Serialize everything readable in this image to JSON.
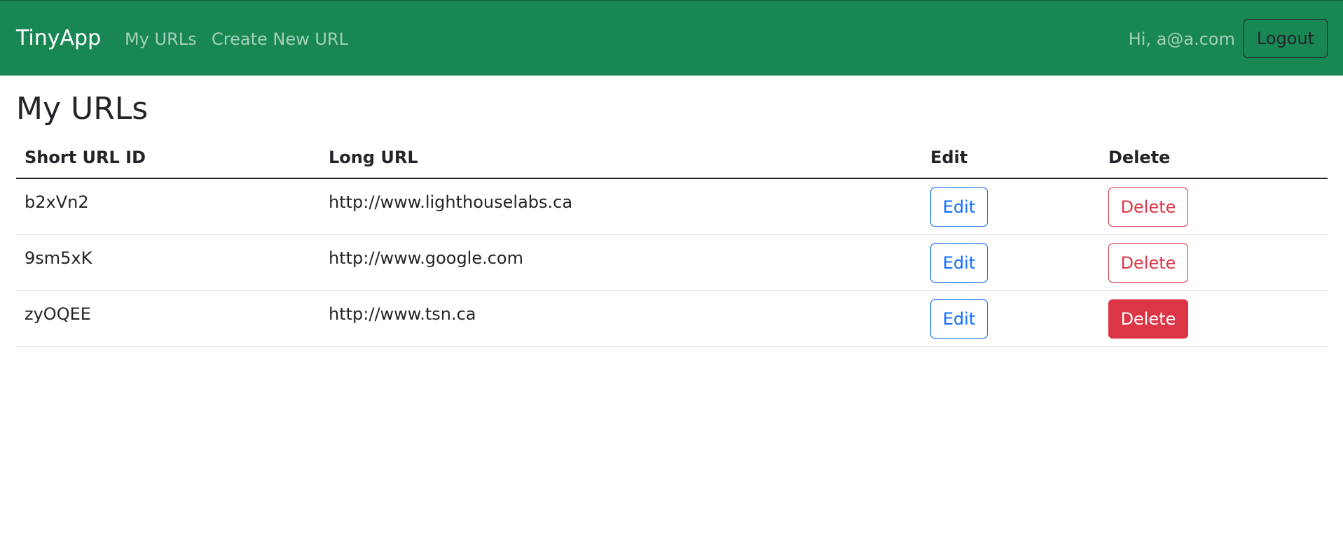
{
  "navbar": {
    "brand": "TinyApp",
    "links": [
      {
        "label": "My URLs"
      },
      {
        "label": "Create New URL"
      }
    ],
    "greeting": "Hi, a@a.com",
    "logout_label": "Logout",
    "background_color": "#198754"
  },
  "main": {
    "title": "My URLs",
    "table": {
      "headers": [
        "Short URL ID",
        "Long URL",
        "Edit",
        "Delete"
      ],
      "rows": [
        {
          "short_id": "b2xVn2",
          "long_url": "http://www.lighthouselabs.ca",
          "edit_label": "Edit",
          "delete_label": "Delete",
          "delete_hovered": false
        },
        {
          "short_id": "9sm5xK",
          "long_url": "http://www.google.com",
          "edit_label": "Edit",
          "delete_label": "Delete",
          "delete_hovered": false
        },
        {
          "short_id": "zyOQEE",
          "long_url": "http://www.tsn.ca",
          "edit_label": "Edit",
          "delete_label": "Delete",
          "delete_hovered": true
        }
      ]
    }
  },
  "colors": {
    "primary": "#0d6efd",
    "danger": "#dc3545",
    "text": "#212529"
  }
}
